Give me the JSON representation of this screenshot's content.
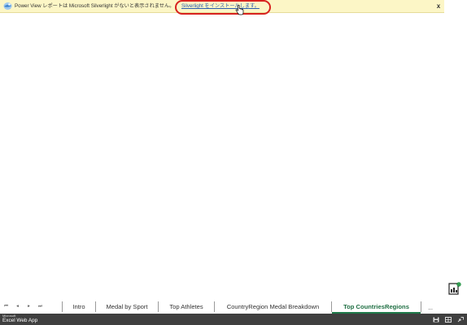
{
  "notification": {
    "message": "Power View レポートは Microsoft Silverlight がないと表示されません。",
    "link_text": "Silverlight をインストールします。",
    "close_label": "x",
    "icon": "silverlight-icon"
  },
  "sheet_nav": {
    "first": "⏮",
    "prev": "◂",
    "next": "▸",
    "last": "⏭"
  },
  "tabs": [
    {
      "label": "Intro",
      "active": false
    },
    {
      "label": "Medal by Sport",
      "active": false
    },
    {
      "label": "Top Athletes",
      "active": false
    },
    {
      "label": "CountryRegion Medal Breakdown",
      "active": false
    },
    {
      "label": "Top CountriesRegions",
      "active": true
    }
  ],
  "tab_more_label": "...",
  "status_bar": {
    "brand_small": "Microsoft",
    "brand_app": "Excel Web App",
    "icons": [
      "save-icon",
      "normal-view-icon",
      "fullscreen-icon"
    ]
  },
  "colors": {
    "notification_bg": "#fcf6c6",
    "highlight_ring": "#d8221f",
    "link": "#2a5db0",
    "active_tab": "#1f6f43",
    "status_bar_bg": "#3f3f3f"
  }
}
